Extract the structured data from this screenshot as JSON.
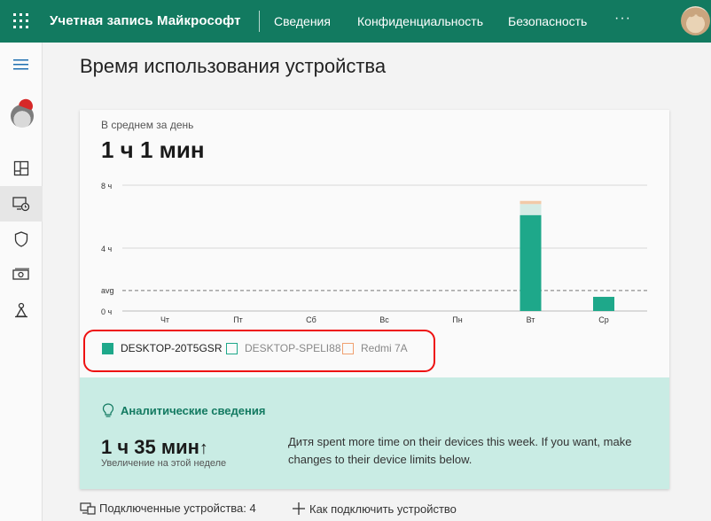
{
  "header": {
    "brand": "Учетная запись Майкрософт",
    "nav": [
      "Сведения",
      "Конфиденциальность",
      "Безопасность"
    ],
    "more": "···",
    "bg_color": "#127a60"
  },
  "sidebar": {
    "icons": [
      "menu-icon",
      "avatar",
      "dashboard-icon",
      "screen-time-icon",
      "shield-icon",
      "money-icon",
      "location-icon"
    ],
    "active": "screen-time-icon"
  },
  "page": {
    "title": "Время использования устройства"
  },
  "card": {
    "avg_label": "В среднем за день",
    "avg_value": "1 ч 1 мин"
  },
  "chart_data": {
    "type": "bar",
    "categories": [
      "Чт",
      "Пт",
      "Сб",
      "Вс",
      "Пн",
      "Вт",
      "Ср"
    ],
    "series": [
      {
        "name": "DESKTOP-20T5GSR",
        "color": "#1ea88a",
        "values": [
          0,
          0,
          0,
          0,
          0,
          6.1,
          0.9
        ]
      },
      {
        "name": "DESKTOP-SPELI88",
        "color": "#d5ebe5",
        "values": [
          0,
          0,
          0,
          0,
          0,
          0.7,
          0
        ]
      },
      {
        "name": "Redmi 7A",
        "color": "#f2c9a8",
        "values": [
          0,
          0,
          0,
          0,
          0,
          0.2,
          0
        ]
      }
    ],
    "stacked": true,
    "yticks": [
      {
        "value": 8,
        "label": "8 ч"
      },
      {
        "value": 4,
        "label": "4 ч"
      },
      {
        "value": 0,
        "label": "0 ч"
      }
    ],
    "avg": {
      "value": 1.3,
      "label": "avg"
    },
    "ylim": [
      0,
      8
    ],
    "grid": true
  },
  "legend": [
    {
      "label": "DESKTOP-20T5GSR",
      "filled": true,
      "color": "#1ea88a",
      "text_color": "#222222"
    },
    {
      "label": "DESKTOP-SPELI88",
      "filled": false,
      "color": "#1ea88a",
      "text_color": "#888888"
    },
    {
      "label": "Redmi 7A",
      "filled": false,
      "color": "#f0a070",
      "text_color": "#888888"
    }
  ],
  "insights": {
    "title": "Аналитические сведения",
    "value": "1 ч 35 мин",
    "arrow": "↑",
    "caption": "Увеличение на этой неделе",
    "text": "Дитя spent more time on their devices this week. If you want, make changes to their device limits below."
  },
  "footer": {
    "devices_link": "Подключенные устройства: 4",
    "connect_link": "Как подключить устройство"
  }
}
